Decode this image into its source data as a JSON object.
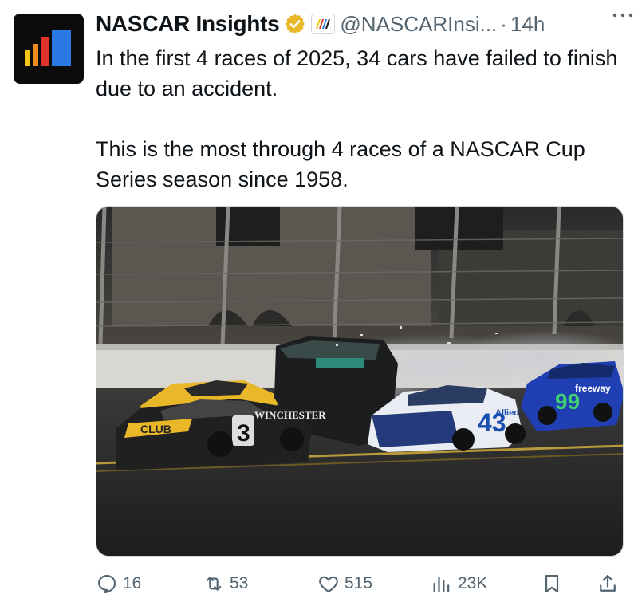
{
  "tweet": {
    "author_name": "NASCAR Insights",
    "handle": "@NASCARInsi...",
    "separator": "·",
    "time": "14h",
    "paragraphs": [
      "In the first 4 races of 2025, 34 cars have failed to finish due to an accident.",
      "This is the most through 4 races of a NASCAR Cup Series season since 1958."
    ],
    "car_decals": {
      "car_3_number": "3",
      "car_3_sponsor": "WINCHESTER",
      "car_3_hood": "CLUB",
      "car_43_number": "43",
      "car_43_sponsor": "Allied",
      "car_99_number": "99",
      "car_99_sponsor": "freeway"
    }
  },
  "actions": {
    "replies": "16",
    "reposts": "53",
    "likes": "515",
    "views": "23K"
  },
  "colors": {
    "text_primary": "#0f1419",
    "text_secondary": "#536471",
    "verified_gold": "#e8b829",
    "avatar_bar_yellow": "#f5c518",
    "avatar_bar_orange": "#f08a1c",
    "avatar_bar_red": "#e0342a",
    "avatar_bar_blue": "#2a78e4"
  },
  "icons": {
    "avatar": "bar-chart-logo-icon",
    "verified": "verified-badge-icon",
    "affiliate": "nascar-affiliate-icon",
    "more": "more-icon",
    "reply": "reply-icon",
    "repost": "repost-icon",
    "like": "like-icon",
    "views": "views-icon",
    "bookmark": "bookmark-icon",
    "share": "share-icon"
  }
}
